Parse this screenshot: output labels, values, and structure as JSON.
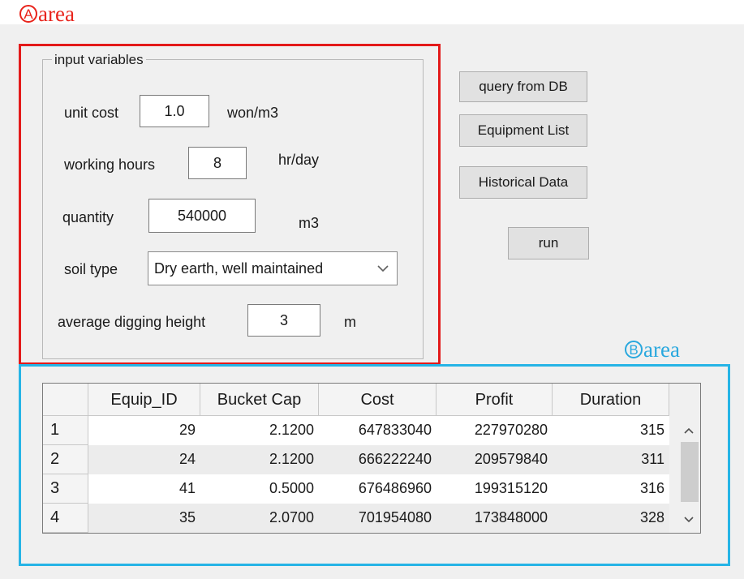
{
  "labels": {
    "area_a_letter": "A",
    "area_a_text": "area",
    "area_b_letter": "B",
    "area_b_text": "area"
  },
  "input_group": {
    "title": "input variables",
    "unit_cost": {
      "label": "unit cost",
      "value": "1.0",
      "unit": "won/m3"
    },
    "working_hours": {
      "label": "working hours",
      "value": "8",
      "unit": "hr/day"
    },
    "quantity": {
      "label": "quantity",
      "value": "540000",
      "unit": "m3"
    },
    "soil_type": {
      "label": "soil type",
      "value": "Dry earth, well maintained"
    },
    "digging_height": {
      "label": "average digging height",
      "value": "3",
      "unit": "m"
    }
  },
  "buttons": {
    "query": "query from DB",
    "equipment": "Equipment List",
    "historical": "Historical Data",
    "run": "run"
  },
  "table": {
    "columns": [
      "Equip_ID",
      "Bucket Cap",
      "Cost",
      "Profit",
      "Duration"
    ],
    "rows": [
      {
        "index": "1",
        "equip_id": "29",
        "bucket_cap": "2.1200",
        "cost": "647833040",
        "profit": "227970280",
        "duration": "315"
      },
      {
        "index": "2",
        "equip_id": "24",
        "bucket_cap": "2.1200",
        "cost": "666222240",
        "profit": "209579840",
        "duration": "311"
      },
      {
        "index": "3",
        "equip_id": "41",
        "bucket_cap": "0.5000",
        "cost": "676486960",
        "profit": "199315120",
        "duration": "316"
      },
      {
        "index": "4",
        "equip_id": "35",
        "bucket_cap": "2.0700",
        "cost": "701954080",
        "profit": "173848000",
        "duration": "328"
      }
    ]
  },
  "colors": {
    "area_a_border": "#e31a1a",
    "area_b_border": "#26b4e6",
    "row_white": "#ffffff",
    "row_alt": "#ececec"
  },
  "icons": {
    "combo_arrow": "chevron-down-icon",
    "scroll_up": "chevron-up-icon",
    "scroll_down": "chevron-down-icon"
  }
}
